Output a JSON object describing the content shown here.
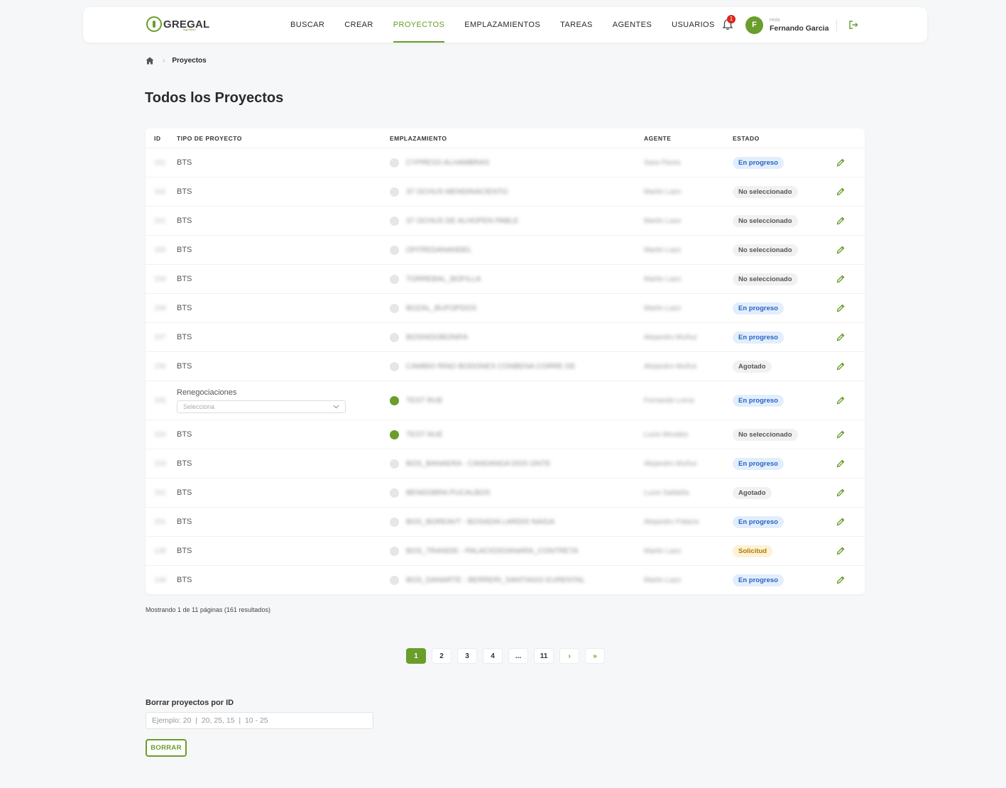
{
  "brand": {
    "name": "GREGAL",
    "sub": "ingeniería"
  },
  "nav": [
    {
      "label": "BUSCAR",
      "active": false
    },
    {
      "label": "CREAR",
      "active": false
    },
    {
      "label": "PROYECTOS",
      "active": true
    },
    {
      "label": "EMPLAZAMIENTOS",
      "active": false
    },
    {
      "label": "TAREAS",
      "active": false
    },
    {
      "label": "AGENTES",
      "active": false
    },
    {
      "label": "USUARIOS",
      "active": false
    }
  ],
  "notifications": {
    "count": "1"
  },
  "user": {
    "initial": "F",
    "greeting": "Hola",
    "name": "Fernando Garcia"
  },
  "breadcrumb": {
    "current": "Proyectos"
  },
  "page": {
    "title": "Todos los Proyectos"
  },
  "table": {
    "headers": {
      "id": "ID",
      "type": "TIPO DE PROYECTO",
      "site": "EMPLAZAMIENTO",
      "agent": "AGENTE",
      "status": "ESTADO"
    },
    "rows": [
      {
        "id": "161",
        "type": "BTS",
        "site": "CYPRESS ALHAMBRAS",
        "site_active": false,
        "agent": "Sara Flores",
        "status": "En progreso",
        "status_kind": "prog"
      },
      {
        "id": "162",
        "type": "BTS",
        "site": "37 OCHUS MENDINACIENTO",
        "site_active": false,
        "agent": "Martin Lazo",
        "status": "No seleccionado",
        "status_kind": "nosel"
      },
      {
        "id": "161",
        "type": "BTS",
        "site": "37 OCHUS DE ALHOPEN PABLE",
        "site_active": false,
        "agent": "Martin Lazo",
        "status": "No seleccionado",
        "status_kind": "nosel"
      },
      {
        "id": "160",
        "type": "BTS",
        "site": "OFFREDANANDEL",
        "site_active": false,
        "agent": "Martin Lazo",
        "status": "No seleccionado",
        "status_kind": "nosel"
      },
      {
        "id": "159",
        "type": "BTS",
        "site": "TORREBAL_BOFILLA",
        "site_active": false,
        "agent": "Martin Lazo",
        "status": "No seleccionado",
        "status_kind": "nosel"
      },
      {
        "id": "158",
        "type": "BTS",
        "site": "BOZAL_BUFOPDOS",
        "site_active": false,
        "agent": "Martin Lazo",
        "status": "En progreso",
        "status_kind": "prog"
      },
      {
        "id": "157",
        "type": "BTS",
        "site": "BOSNIDOBONIFA",
        "site_active": false,
        "agent": "Alejandro Muñoz",
        "status": "En progreso",
        "status_kind": "prog"
      },
      {
        "id": "156",
        "type": "BTS",
        "site": "CAMBIO RINO BODONES CONBENA CORRE DE",
        "site_active": false,
        "agent": "Alejandro Muñoz",
        "status": "Agotado",
        "status_kind": "agot"
      },
      {
        "id": "155",
        "type": "Renegociaciones",
        "type_select": "Selecciona",
        "site": "TEST RUE",
        "site_active": true,
        "agent": "Fernando Lorca",
        "status": "En progreso",
        "status_kind": "prog"
      },
      {
        "id": "154",
        "type": "BTS",
        "site": "TEST NUE",
        "site_active": true,
        "agent": "Lucio Morales",
        "status": "No seleccionado",
        "status_kind": "nosel"
      },
      {
        "id": "153",
        "type": "BTS",
        "site": "BOS_BANAERA - CANDANGA DOS ONTE",
        "site_active": false,
        "agent": "Alejandro Muñoz",
        "status": "En progreso",
        "status_kind": "prog"
      },
      {
        "id": "152",
        "type": "BTS",
        "site": "BENDOBRA PUCALBOS",
        "site_active": false,
        "agent": "Lucio Saldaña",
        "status": "Agotado",
        "status_kind": "agot"
      },
      {
        "id": "151",
        "type": "BTS",
        "site": "BOS_BOREAVT - BOSADIA LARDIS NAIGA",
        "site_active": false,
        "agent": "Alejandro Palacio",
        "status": "En progreso",
        "status_kind": "prog"
      },
      {
        "id": "138",
        "type": "BTS",
        "site": "BOS_TRANDIE - PALACIOSOANARA_CONTRETA",
        "site_active": false,
        "agent": "Martin Lazo",
        "status": "Solicitud",
        "status_kind": "sol"
      },
      {
        "id": "148",
        "type": "BTS",
        "site": "BOS_DANARTE - BERRERI_SANTIAGO EURENTAL",
        "site_active": false,
        "agent": "Martin Lazo",
        "status": "En progreso",
        "status_kind": "prog"
      }
    ]
  },
  "results": {
    "text": "Mostrando 1 de 11 páginas (161 resultados)"
  },
  "pagination": {
    "pages": [
      "1",
      "2",
      "3",
      "4",
      "...",
      "11"
    ],
    "current": "1",
    "next": "›",
    "last": "»"
  },
  "delete": {
    "label": "Borrar proyectos por ID",
    "placeholder": "Ejemplo: 20  |  20, 25, 15  |  10 - 25",
    "button": "BORRAR"
  },
  "colors": {
    "accent": "#6a9d2b",
    "badge_alert": "#d9261c"
  }
}
